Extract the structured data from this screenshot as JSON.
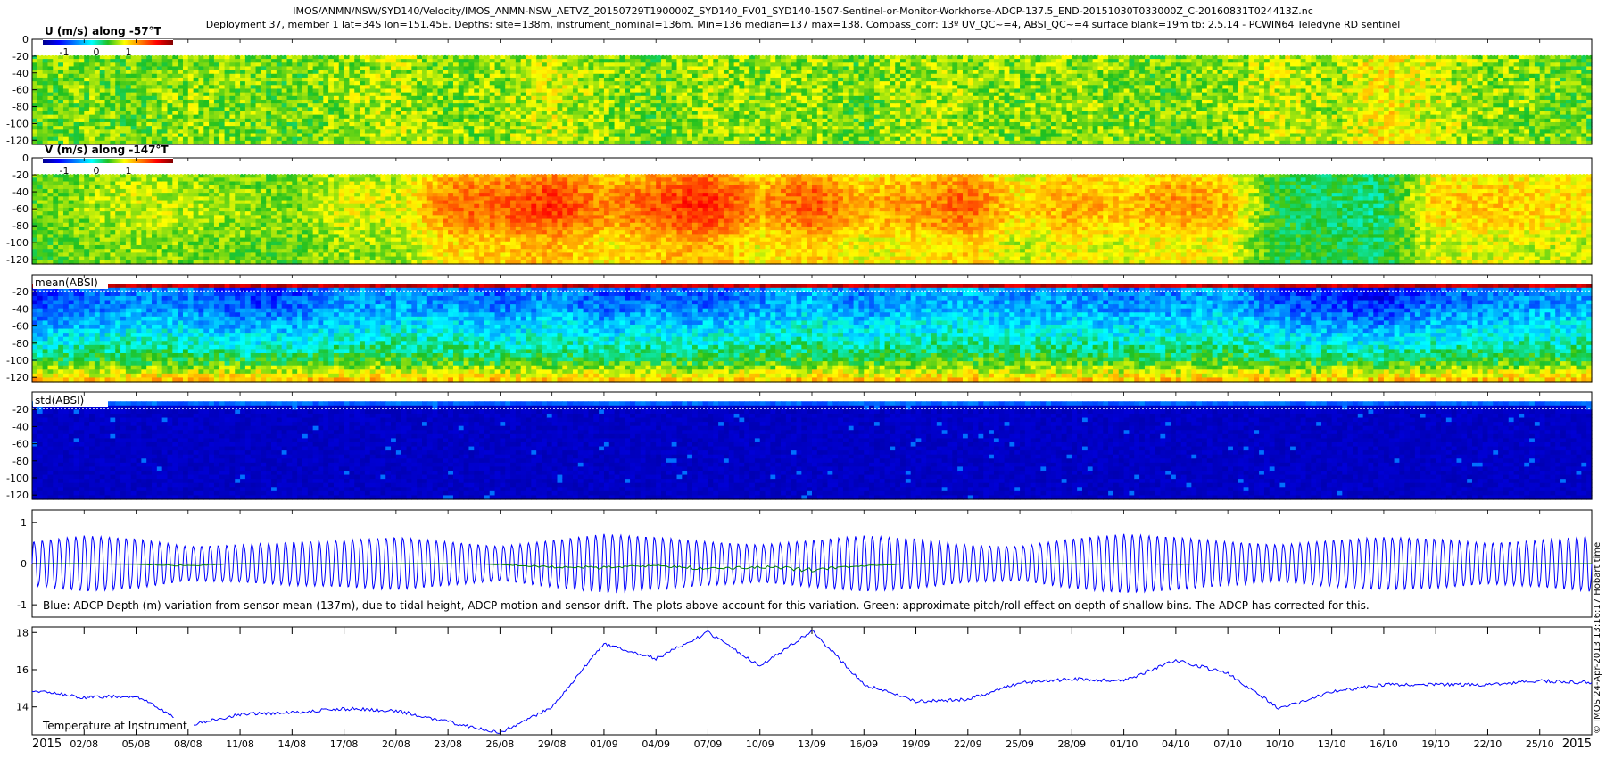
{
  "header": {
    "title_line1": "IMOS/ANMN/NSW/SYD140/Velocity/IMOS_ANMN-NSW_AETVZ_20150729T190000Z_SYD140_FV01_SYD140-1507-Sentinel-or-Monitor-Workhorse-ADCP-137.5_END-20151030T033000Z_C-20160831T024413Z.nc",
    "title_line2": "Deployment 37, member 1 lat=34S lon=151.45E. Depths: site=138m, instrument_nominal=136m. Min=136 median=137 max=138. Compass_corr: 13º UV_QC~=4, ABSI_QC~=4 surface blank=19m tb: 2.5.14 - PCWIN64 Teledyne RD sentinel"
  },
  "side_label": "© IMOS 24-Apr-2013 13:16:17 Hobart time",
  "colors": {
    "jet_dark_blue": "#00008f",
    "jet_blue": "#0050ff",
    "jet_cyan": "#00ffff",
    "jet_green": "#20c020",
    "jet_yellow": "#ffff00",
    "jet_orange": "#ff8000",
    "jet_red": "#800000",
    "depth_line": "#0000ff",
    "pitch_roll_line": "#008000",
    "temp_line": "#0000ff",
    "blank_line": "#ffffff"
  },
  "chart_data": [
    {
      "type": "heatmap",
      "title": "U (m/s) along -57°T",
      "colorbar_ticks": [
        "-1",
        "0",
        "1"
      ],
      "clim": [
        -1.5,
        1.5
      ],
      "ylim": [
        -125,
        0
      ],
      "yticks": [
        "0",
        "-20",
        "-40",
        "-60",
        "-80",
        "-100",
        "-120"
      ],
      "surface_blank_depth": -19,
      "x": [
        "2015",
        "02/08",
        "05/08",
        "08/08",
        "11/08",
        "14/08",
        "17/08",
        "20/08",
        "23/08",
        "26/08",
        "29/08",
        "01/09",
        "04/09",
        "07/09",
        "10/09",
        "13/09",
        "16/09",
        "19/09",
        "22/09",
        "25/09",
        "28/09",
        "01/10",
        "04/10",
        "07/10",
        "10/10",
        "13/10",
        "16/10",
        "19/10",
        "22/10",
        "25/10",
        "2015"
      ],
      "values": [
        0.1,
        0.15,
        0.1,
        0.2,
        0.15,
        0.1,
        0.2,
        0.25,
        0.15,
        0.2,
        0.3,
        0.2,
        0.1,
        0.25,
        0.15,
        0.2,
        0.1,
        0.25,
        0.2,
        0.15,
        0.2,
        0.15,
        0.1,
        0.2,
        0.3,
        0.2,
        0.45,
        0.3,
        0.2,
        0.15,
        0.1
      ]
    },
    {
      "type": "heatmap",
      "title": "V (m/s) along -147°T",
      "colorbar_ticks": [
        "-1",
        "0",
        "1"
      ],
      "clim": [
        -1.5,
        1.5
      ],
      "ylim": [
        -125,
        0
      ],
      "yticks": [
        "0",
        "-20",
        "-40",
        "-60",
        "-80",
        "-100",
        "-120"
      ],
      "surface_blank_depth": -19,
      "x": [
        "2015",
        "02/08",
        "05/08",
        "08/08",
        "11/08",
        "14/08",
        "17/08",
        "20/08",
        "23/08",
        "26/08",
        "29/08",
        "01/09",
        "04/09",
        "07/09",
        "10/09",
        "13/09",
        "16/09",
        "19/09",
        "22/09",
        "25/09",
        "28/09",
        "01/10",
        "04/10",
        "07/10",
        "10/10",
        "13/10",
        "16/10",
        "19/10",
        "22/10",
        "25/10",
        "2015"
      ],
      "values": [
        0.1,
        0.2,
        0.3,
        0.25,
        0.2,
        0.15,
        0.35,
        0.3,
        0.8,
        0.85,
        1.0,
        0.7,
        0.9,
        1.05,
        0.65,
        0.9,
        0.6,
        0.7,
        0.85,
        0.45,
        0.65,
        0.55,
        0.7,
        0.6,
        -0.05,
        -0.1,
        -0.15,
        0.5,
        0.55,
        0.5,
        0.45
      ]
    },
    {
      "type": "heatmap",
      "title": "mean(ABSI)",
      "ylim": [
        -125,
        0
      ],
      "yticks": [
        "-20",
        "-40",
        "-60",
        "-80",
        "-100",
        "-120"
      ],
      "surface_blank_depth": -19,
      "values_top_band": 0.85,
      "values_profile_by_depth": [
        -0.55,
        -0.5,
        -0.35,
        -0.2,
        0.0,
        0.35
      ],
      "x": [
        "2015",
        "02/08",
        "05/08",
        "08/08",
        "11/08",
        "14/08",
        "17/08",
        "20/08",
        "23/08",
        "26/08",
        "29/08",
        "01/09",
        "04/09",
        "07/09",
        "10/09",
        "13/09",
        "16/09",
        "19/09",
        "22/09",
        "25/09",
        "28/09",
        "01/10",
        "04/10",
        "07/10",
        "10/10",
        "13/10",
        "16/10",
        "19/10",
        "22/10",
        "25/10",
        "2015"
      ],
      "values": [
        -0.65,
        -0.5,
        -0.4,
        -0.45,
        -0.6,
        -0.55,
        -0.4,
        -0.35,
        -0.4,
        -0.5,
        -0.35,
        -0.55,
        -0.45,
        -0.5,
        -0.4,
        -0.3,
        -0.45,
        -0.35,
        -0.3,
        -0.4,
        -0.35,
        -0.45,
        -0.4,
        -0.3,
        -0.55,
        -0.6,
        -0.7,
        -0.5,
        -0.45,
        -0.4,
        -0.35
      ]
    },
    {
      "type": "heatmap",
      "title": "std(ABSI)",
      "ylim": [
        -125,
        0
      ],
      "yticks": [
        "-20",
        "-40",
        "-60",
        "-80",
        "-100",
        "-120"
      ],
      "surface_blank_depth": -19,
      "values_top_band": -0.55,
      "values_body": -0.88
    },
    {
      "type": "line",
      "ylim": [
        -1.3,
        1.3
      ],
      "yticks": [
        "1",
        "0",
        "-1"
      ],
      "caption": "Blue: ADCP Depth (m) variation from sensor-mean (137m), due to tidal height, ADCP motion and sensor drift. The plots above account for this variation. Green: approximate pitch/roll effect on depth of shallow bins. The ADCP has corrected for this.",
      "series": [
        {
          "name": "ADCP Depth (m) variation from sensor-mean",
          "cycles": 186,
          "amplitude_envelope": [
            0.7,
            0.9,
            0.8,
            0.55,
            0.6,
            0.7,
            0.75,
            0.85,
            0.7,
            0.55,
            0.75,
            0.95,
            0.85,
            0.7,
            0.6,
            0.75,
            0.9,
            0.8,
            0.6,
            0.55,
            0.8,
            0.95,
            0.85,
            0.7,
            0.6,
            0.75,
            0.85,
            0.8,
            0.65,
            0.75,
            0.9
          ]
        },
        {
          "name": "approximate pitch/roll effect on depth of shallow bins",
          "values": [
            0.0,
            0.0,
            -0.02,
            -0.05,
            0.0,
            0.0,
            0.0,
            0.0,
            0.0,
            -0.02,
            -0.08,
            -0.1,
            -0.05,
            -0.12,
            -0.08,
            -0.15,
            -0.05,
            0.0,
            0.0,
            0.0,
            0.0,
            0.0,
            -0.02,
            0.0,
            0.0,
            0.0,
            0.0,
            0.0,
            0.0,
            0.0,
            0.0
          ]
        }
      ]
    },
    {
      "type": "line",
      "ylim": [
        12.5,
        18.3
      ],
      "yticks": [
        "18",
        "16",
        "14"
      ],
      "label": "Temperature at Instrument",
      "x": [
        "2015",
        "02/08",
        "05/08",
        "08/08",
        "11/08",
        "14/08",
        "17/08",
        "20/08",
        "23/08",
        "26/08",
        "29/08",
        "01/09",
        "04/09",
        "07/09",
        "10/09",
        "13/09",
        "16/09",
        "19/09",
        "22/09",
        "25/09",
        "28/09",
        "01/10",
        "04/10",
        "07/10",
        "10/10",
        "13/10",
        "16/10",
        "19/10",
        "22/10",
        "25/10",
        "2015"
      ],
      "values": [
        14.9,
        14.5,
        14.6,
        13.0,
        13.6,
        13.7,
        13.9,
        13.8,
        13.2,
        12.6,
        14.0,
        17.4,
        16.6,
        18.0,
        16.2,
        18.1,
        15.2,
        14.3,
        14.4,
        15.3,
        15.5,
        15.4,
        16.5,
        15.8,
        13.9,
        14.8,
        15.2,
        15.2,
        15.2,
        15.4,
        15.3
      ]
    }
  ]
}
